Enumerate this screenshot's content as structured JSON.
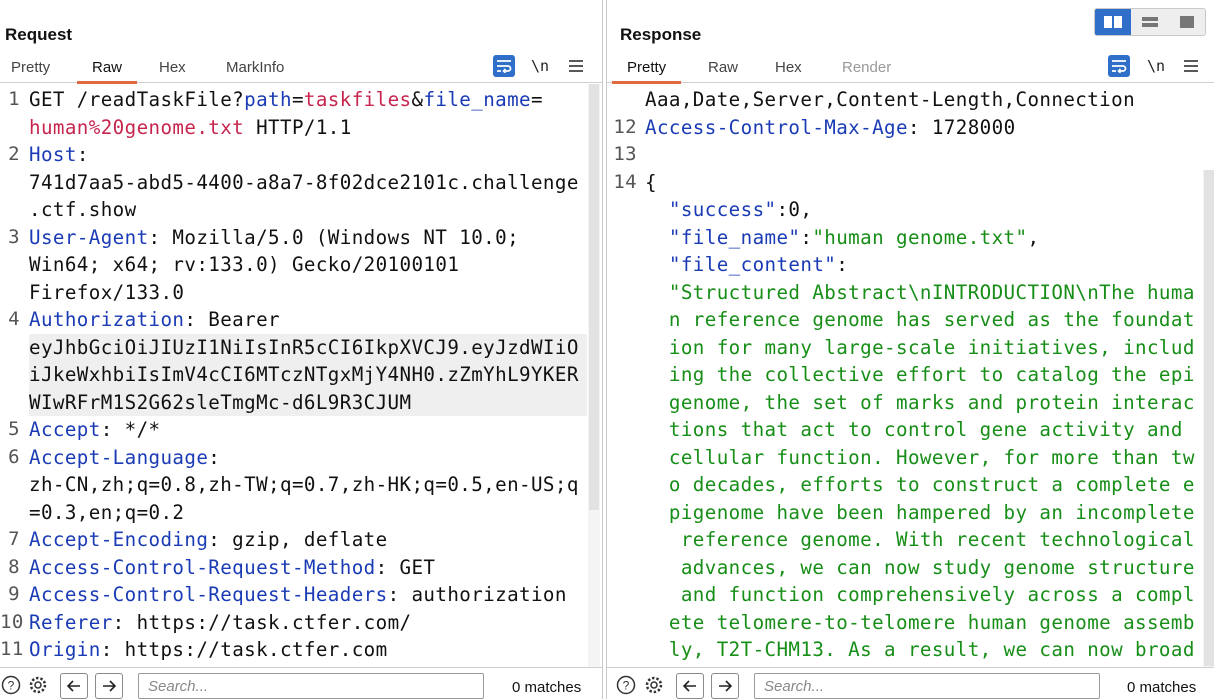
{
  "request": {
    "title": "Request",
    "tabs": [
      "Pretty",
      "Raw",
      "Hex",
      "MarkInfo"
    ],
    "active_tab": "Raw",
    "line_numbers": [
      "1",
      "2",
      "3",
      "4",
      "5",
      "6",
      "7",
      "8",
      "9",
      "10",
      "11"
    ],
    "lines": [
      {
        "n": "1",
        "parts": [
          "GET /readTaskFile?",
          "path",
          "=",
          "taskfiles",
          "&",
          "file_name",
          "="
        ]
      },
      {
        "n": "",
        "parts": [
          "human%20genome.txt",
          " HTTP/1.1"
        ]
      },
      {
        "n": "2",
        "parts": [
          "Host",
          ":"
        ]
      },
      {
        "n": "",
        "text": "741d7aa5-abd5-4400-a8a7-8f02dce2101c.challenge"
      },
      {
        "n": "",
        "text": ".ctf.show"
      },
      {
        "n": "3",
        "parts": [
          "User-Agent",
          ": Mozilla/5.0 (Windows NT 10.0;"
        ]
      },
      {
        "n": "",
        "text": "Win64; x64; rv:133.0) Gecko/20100101"
      },
      {
        "n": "",
        "text": "Firefox/133.0"
      },
      {
        "n": "4",
        "parts": [
          "Authorization",
          ": Bearer"
        ]
      },
      {
        "n": "",
        "text": "eyJhbGciOiJIUzI1NiIsInR5cCI6IkpXVCJ9.eyJzdWIiO"
      },
      {
        "n": "",
        "text": "iJkeWxhbiIsImV4cCI6MTczNTgxMjY4NH0.zZmYhL9YKER"
      },
      {
        "n": "",
        "text": "WIwRFrM1S2G62sleTmgMc-d6L9R3CJUM"
      },
      {
        "n": "5",
        "parts": [
          "Accept",
          ": */*"
        ]
      },
      {
        "n": "6",
        "parts": [
          "Accept-Language",
          ":"
        ]
      },
      {
        "n": "",
        "text": "zh-CN,zh;q=0.8,zh-TW;q=0.7,zh-HK;q=0.5,en-US;q"
      },
      {
        "n": "",
        "text": "=0.3,en;q=0.2"
      },
      {
        "n": "7",
        "parts": [
          "Accept-Encoding",
          ": gzip, deflate"
        ]
      },
      {
        "n": "8",
        "parts": [
          "Access-Control-Request-Method",
          ": GET"
        ]
      },
      {
        "n": "9",
        "parts": [
          "Access-Control-Request-Headers",
          ": authorization"
        ]
      },
      {
        "n": "10",
        "parts": [
          "Referer",
          ": https://task.ctfer.com/"
        ]
      },
      {
        "n": "11",
        "parts": [
          "Origin",
          ": https://task.ctfer.com"
        ]
      }
    ],
    "search_placeholder": "Search...",
    "matches": "0 matches"
  },
  "response": {
    "title": "Response",
    "tabs": [
      "Pretty",
      "Raw",
      "Hex",
      "Render"
    ],
    "active_tab": "Pretty",
    "lines": [
      {
        "n": "",
        "text": "Aaa,Date,Server,Content-Length,Connection"
      },
      {
        "n": "12",
        "parts": [
          "Access-Control-Max-Age",
          ": 1728000"
        ]
      },
      {
        "n": "13",
        "text": ""
      },
      {
        "n": "14",
        "text": "{"
      },
      {
        "n": "",
        "parts": [
          "  \"success\"",
          ":0,"
        ]
      },
      {
        "n": "",
        "parts": [
          "  \"file_name\"",
          ":",
          "\"human genome.txt\"",
          ","
        ]
      },
      {
        "n": "",
        "parts": [
          "  \"file_content\"",
          ":"
        ]
      },
      {
        "n": "",
        "text": "  \"Structured Abstract\\nINTRODUCTION\\nThe huma"
      },
      {
        "n": "",
        "text": "  n reference genome has served as the foundat"
      },
      {
        "n": "",
        "text": "  ion for many large-scale initiatives, includ"
      },
      {
        "n": "",
        "text": "  ing the collective effort to catalog the epi"
      },
      {
        "n": "",
        "text": "  genome, the set of marks and protein interac"
      },
      {
        "n": "",
        "text": "  tions that act to control gene activity and"
      },
      {
        "n": "",
        "text": "  cellular function. However, for more than tw"
      },
      {
        "n": "",
        "text": "  o decades, efforts to construct a complete e"
      },
      {
        "n": "",
        "text": "  pigenome have been hampered by an incomplete"
      },
      {
        "n": "",
        "text": "   reference genome. With recent technological"
      },
      {
        "n": "",
        "text": "   advances, we can now study genome structure"
      },
      {
        "n": "",
        "text": "   and function comprehensively across a compl"
      },
      {
        "n": "",
        "text": "  ete telomere-to-telomere human genome assemb"
      },
      {
        "n": "",
        "text": "  ly, T2T-CHM13. As a result, we can now broad"
      }
    ],
    "search_placeholder": "Search...",
    "matches": "0 matches"
  },
  "colors": {
    "accent": "#e06a3f",
    "key": "#1a3bb5",
    "param": "#c7254e",
    "string": "#178e17",
    "toggle": "#2f6ec9"
  },
  "icons": [
    "wrap-lines-icon",
    "newline-icon",
    "menu-icon",
    "help-icon",
    "settings-icon",
    "arrow-left-icon",
    "arrow-right-icon",
    "layout-split-icon",
    "layout-horizontal-icon",
    "layout-single-icon"
  ]
}
